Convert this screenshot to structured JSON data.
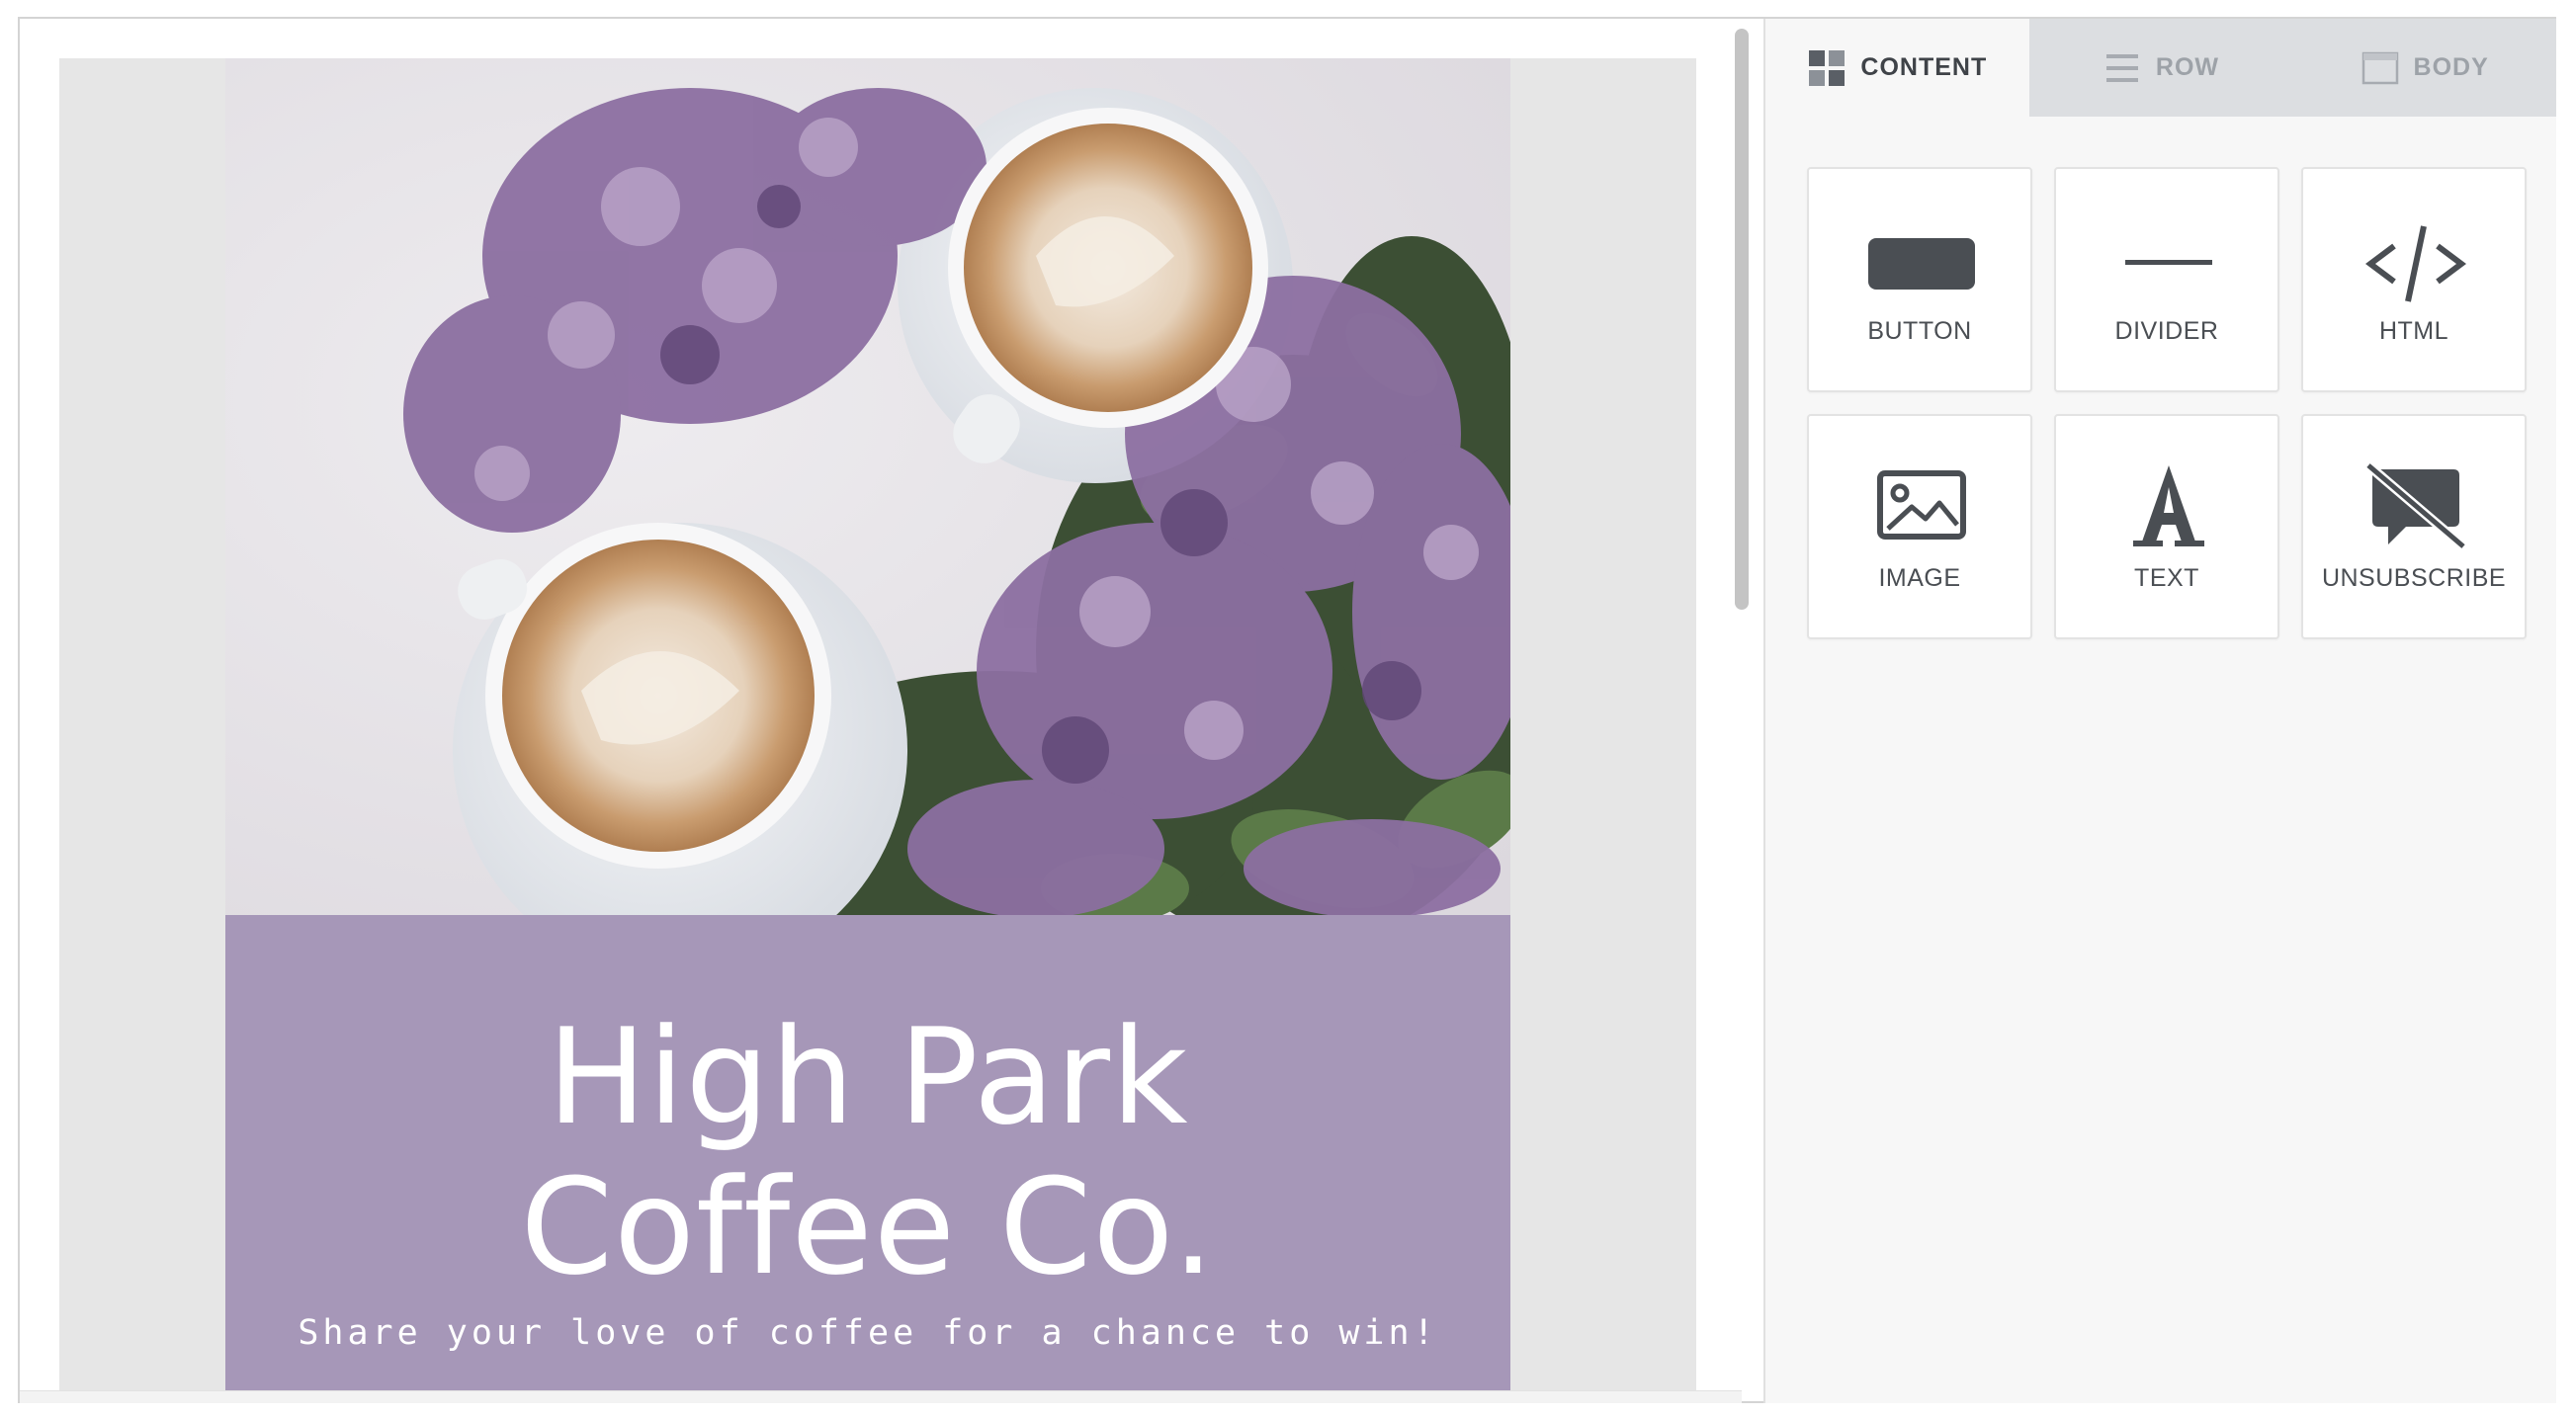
{
  "email": {
    "title_line1": "High Park",
    "title_line2": "Coffee Co.",
    "tagline": "Share your love of coffee for a chance to win!",
    "background_color": "#a697b8"
  },
  "panel": {
    "tabs": [
      {
        "label": "CONTENT",
        "icon": "content-grid-icon",
        "active": true
      },
      {
        "label": "ROW",
        "icon": "rows-icon",
        "active": false
      },
      {
        "label": "BODY",
        "icon": "body-window-icon",
        "active": false
      }
    ],
    "tiles": [
      {
        "label": "BUTTON",
        "icon": "button-icon"
      },
      {
        "label": "DIVIDER",
        "icon": "divider-icon"
      },
      {
        "label": "HTML",
        "icon": "code-icon"
      },
      {
        "label": "IMAGE",
        "icon": "image-icon"
      },
      {
        "label": "TEXT",
        "icon": "text-icon"
      },
      {
        "label": "UNSUBSCRIBE",
        "icon": "unsubscribe-icon"
      }
    ]
  },
  "colors": {
    "tab_inactive_bg": "#dcdee1",
    "panel_bg": "#f7f7f7",
    "icon_dark": "#4a4e53"
  }
}
